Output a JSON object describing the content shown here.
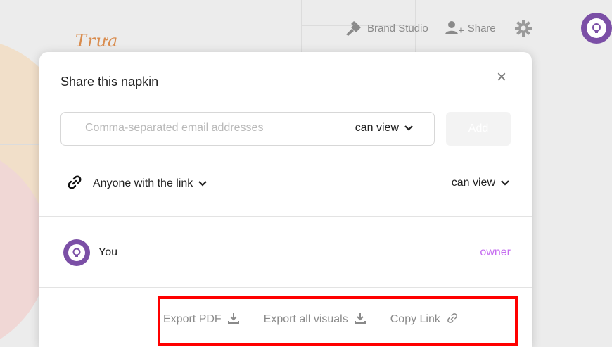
{
  "canvas": {
    "title": "Trưa"
  },
  "toolbar": {
    "brand_studio_label": "Brand Studio",
    "share_label": "Share",
    "icons": [
      "brand-studio-icon",
      "share-user-icon",
      "gear-icon",
      "user-avatar-icon"
    ]
  },
  "dialog": {
    "title": "Share this napkin",
    "close_glyph": "×",
    "email_placeholder": "Comma-separated email addresses",
    "email_value": "",
    "invite_permission": "can view",
    "add_label": "Add",
    "link_scope": "Anyone with the link",
    "link_permission": "can view",
    "members": [
      {
        "name": "You",
        "role": "owner"
      }
    ],
    "footer": {
      "export_pdf": "Export PDF",
      "export_visuals": "Export all visuals",
      "copy_link": "Copy Link"
    }
  },
  "colors": {
    "accent_purple": "#7b4fa6",
    "owner_role": "#c56cf0",
    "highlight": "#ff0000",
    "title_orange": "#d98c4e"
  }
}
